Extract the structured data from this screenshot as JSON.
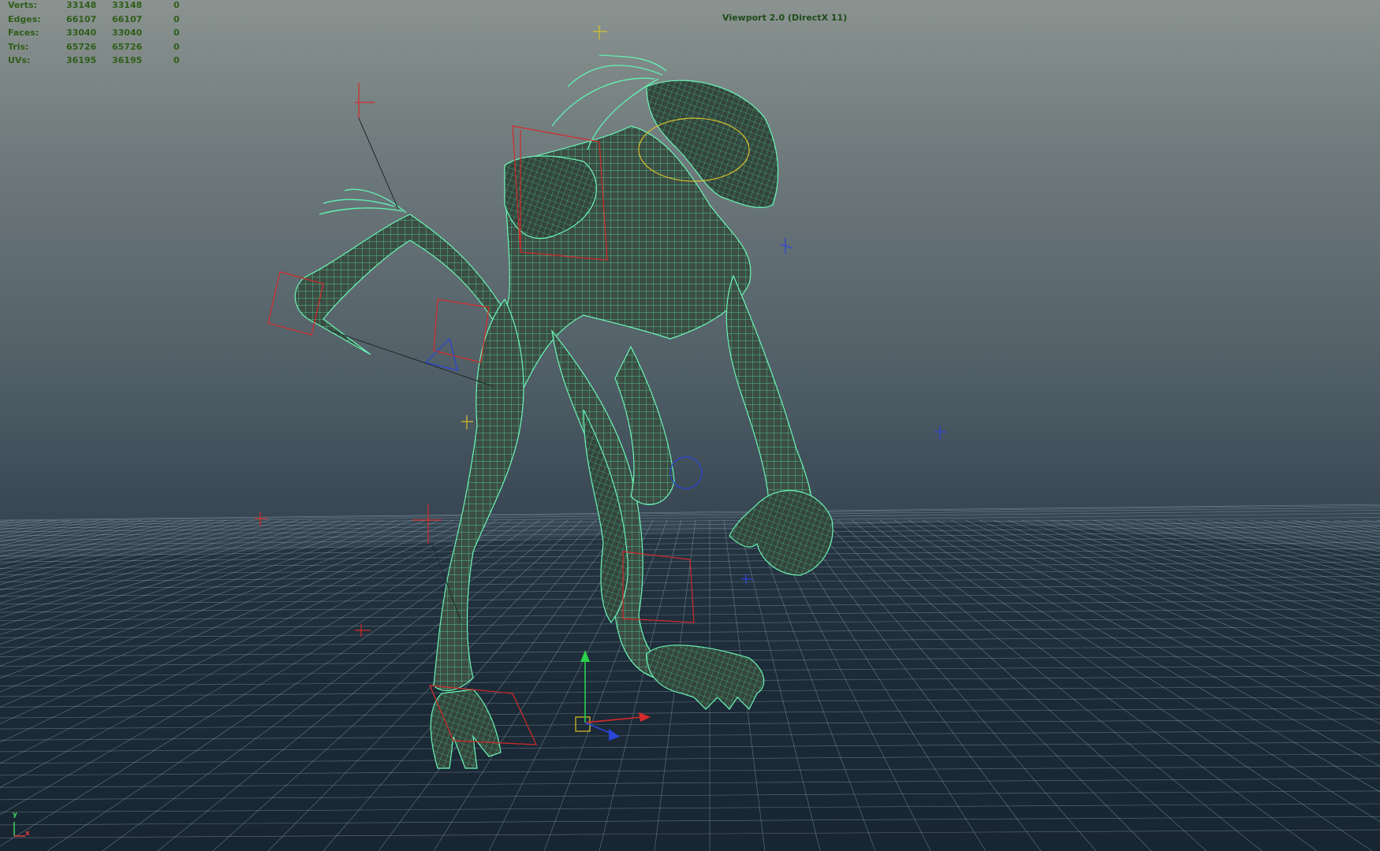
{
  "viewport": {
    "title": "Viewport 2.0 (DirectX 11)",
    "background": {
      "top": "#8a9390",
      "bottom": "#16222d"
    },
    "grid_color": "#9fb4c6",
    "wireframe_color": "#4ef0a8",
    "mesh_fill": "#3d5046"
  },
  "hud": {
    "rows": [
      {
        "label": "Verts:",
        "values": [
          "33148",
          "33148",
          "0"
        ]
      },
      {
        "label": "Edges:",
        "values": [
          "66107",
          "66107",
          "0"
        ]
      },
      {
        "label": "Faces:",
        "values": [
          "33040",
          "33040",
          "0"
        ]
      },
      {
        "label": "Tris:",
        "values": [
          "65726",
          "65726",
          "0"
        ]
      },
      {
        "label": "UVs:",
        "values": [
          "36195",
          "36195",
          "0"
        ]
      }
    ]
  },
  "axis_indicator": {
    "y": "y",
    "x": "x"
  },
  "gizmo": {
    "icon": "move-manipulator-icon"
  }
}
